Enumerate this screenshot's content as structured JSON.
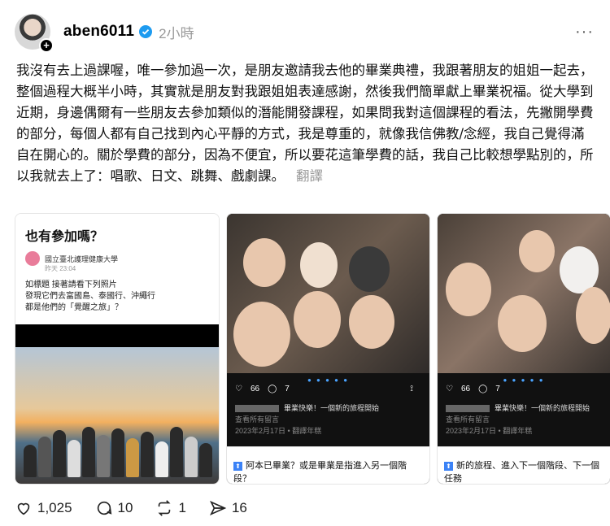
{
  "post": {
    "username": "aben6011",
    "time": "2小時",
    "more": "···",
    "text": "我沒有去上過課喔，唯一參加過一次，是朋友邀請我去他的畢業典禮，我跟著朋友的姐姐一起去，整個過程大概半小時，其實就是朋友對我跟姐姐表達感謝，然後我們簡單獻上畢業祝福。從大學到近期，身邊偶爾有一些朋友去參加類似的潛能開發課程，如果問我對這個課程的看法，先撇開學費的部分，每個人都有自己找到內心平靜的方式，我是尊重的，就像我信佛教/念經，我自己覺得滿自在開心的。關於學費的部分，因為不便宜，所以要花這筆學費的話，我自己比較想學點別的，所以我就去上了：唱歌、日文、跳舞、戲劇課。",
    "translate": "翻譯"
  },
  "card1": {
    "question": "也有參加嗎？",
    "source_name": "國立臺北護理健康大學",
    "source_date": "昨天 23:04",
    "body_lines": [
      "如標題 接著請看下列照片",
      "發現它們去富國島、泰國行、沖繩行",
      "都是他們的「覺醒之旅」？"
    ]
  },
  "card2": {
    "likes": "66",
    "comments": "7",
    "caption": "畢業快樂！一個新的旅程開始",
    "view_comments": "查看所有留言",
    "date": "2023年2月17日 • 翻譯年糕",
    "note": "阿本已畢業？或是畢業是指進入另一個階段？"
  },
  "card3": {
    "likes": "66",
    "comments": "7",
    "caption": "畢業快樂！一個新的旅程開始",
    "view_comments": "查看所有留言",
    "date": "2023年2月17日 • 翻譯年糕",
    "note": "新的旅程、進入下一個階段、下一個任務"
  },
  "actions": {
    "likes": "1,025",
    "comments": "10",
    "reposts": "1",
    "shares": "16"
  },
  "colors": {
    "verified": "#1d9bf0",
    "muted": "#999999"
  }
}
